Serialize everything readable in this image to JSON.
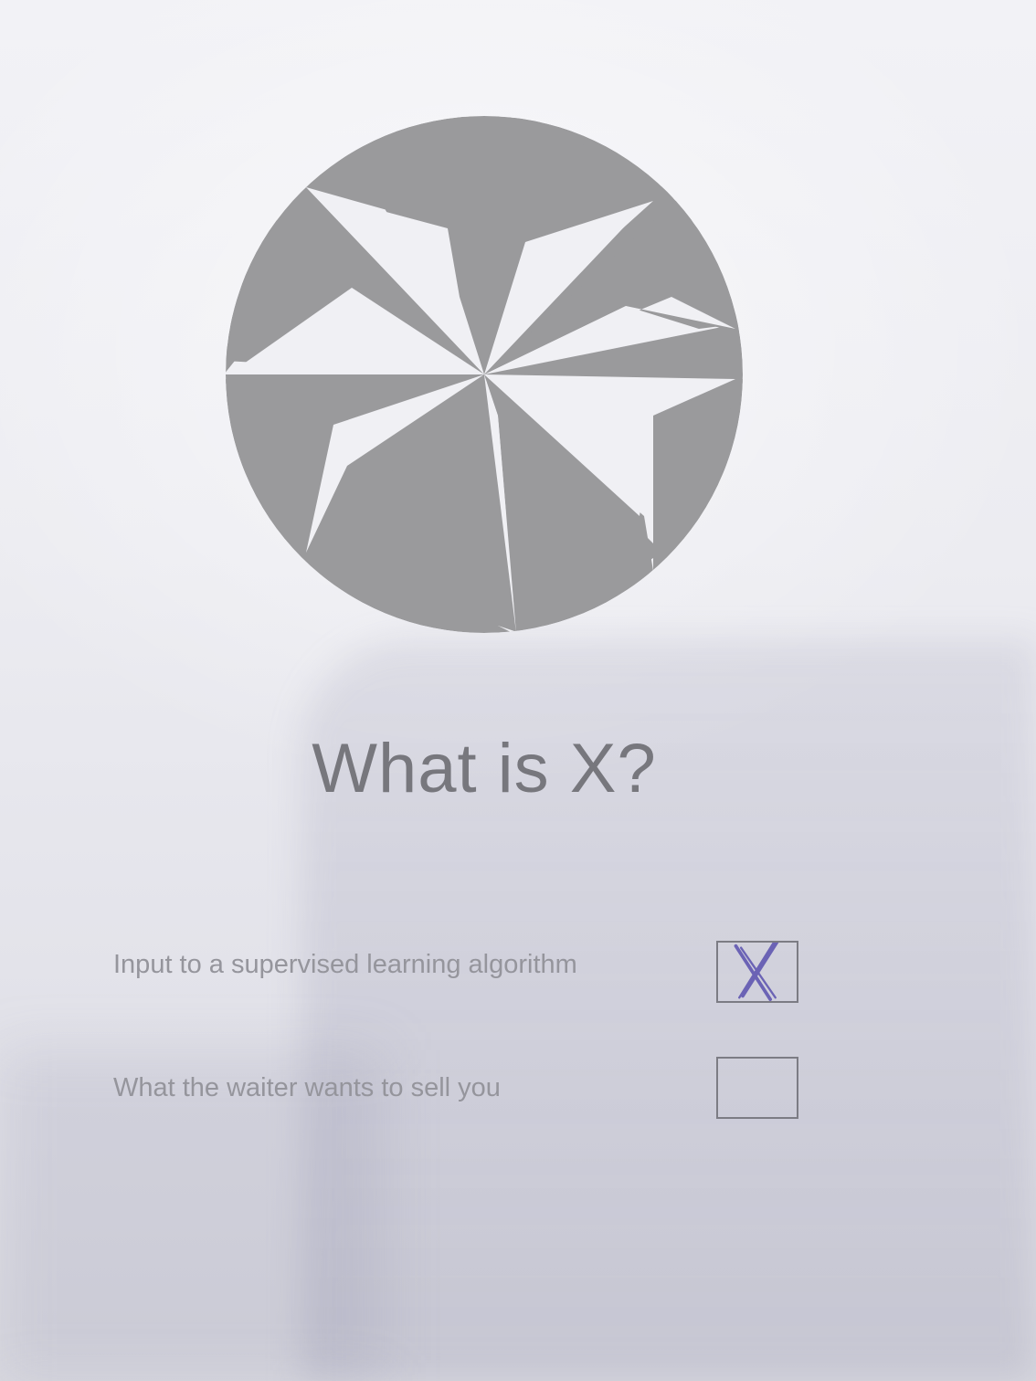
{
  "heading": "What is X?",
  "options": [
    {
      "label": "Input to a supervised learning algorithm",
      "checked": true
    },
    {
      "label": "What the waiter wants to sell you",
      "checked": false
    }
  ],
  "colors": {
    "logo_gray": "#9a9a9c",
    "text_gray": "#77777d",
    "option_gray": "#95959c",
    "check_mark": "#6b63b5"
  },
  "icons": {
    "logo": "pinwheel-logo-icon",
    "mark": "x-mark-icon"
  }
}
